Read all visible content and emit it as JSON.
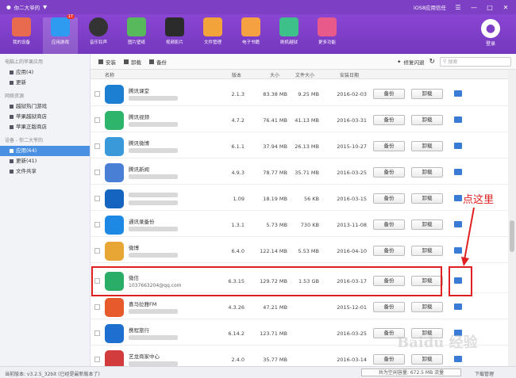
{
  "titlebar": {
    "device": "你二大爷的",
    "device_icon": "apple-icon",
    "brand": "iOS8应用信任"
  },
  "toolbar": {
    "tools": [
      {
        "label": "我的设备",
        "color": "#e86a4f",
        "icon": "store-icon"
      },
      {
        "label": "应用游戏",
        "color": "#2f9bf0",
        "icon": "appstore-icon",
        "badge": "17"
      },
      {
        "label": "音乐铃声",
        "color": "#333333",
        "icon": "music-icon"
      },
      {
        "label": "图片壁纸",
        "color": "#58b85c",
        "icon": "image-icon"
      },
      {
        "label": "视频影片",
        "color": "#2b2b2b",
        "icon": "video-icon"
      },
      {
        "label": "文件管理",
        "color": "#f2a33a",
        "icon": "folder-icon"
      },
      {
        "label": "电子书籍",
        "color": "#f5a142",
        "icon": "book-icon"
      },
      {
        "label": "刷机越狱",
        "color": "#3ec08a",
        "icon": "flash-icon"
      },
      {
        "label": "更多功能",
        "color": "#e85a8a",
        "icon": "grid-icon"
      }
    ],
    "login": "登录"
  },
  "sidebar": {
    "sec1": "电脑上的苹果应用",
    "sec1_items": [
      "应用(4)",
      "更新"
    ],
    "sec2": "网络资源",
    "sec2_items": [
      "越狱热门游戏",
      "苹果越狱商店",
      "苹果正版商店"
    ],
    "sec3": "设备 - 你二大爷的",
    "sec3_items": [
      "应用(64)",
      "更新(41)",
      "文件共享"
    ]
  },
  "actions": {
    "install": "安装",
    "uninstall": "卸载",
    "backup": "备份",
    "fix": "修复闪退",
    "search_placeholder": "搜索"
  },
  "columns": {
    "name": "名称",
    "version": "版本",
    "size": "大小",
    "docsize": "文件大小",
    "date": "安装日期"
  },
  "buttons": {
    "backup": "备份",
    "uninstall": "卸载"
  },
  "rows": [
    {
      "name": "腾讯课堂",
      "sub": "",
      "version": "2.1.3",
      "size": "83.38 MB",
      "docsize": "9.25 MB",
      "date": "2016-02-03",
      "color": "#1d7fd1"
    },
    {
      "name": "腾讯视频",
      "sub": "",
      "version": "4.7.2",
      "size": "76.41 MB",
      "docsize": "41.13 MB",
      "date": "2016-03-31",
      "color": "#2fb56b"
    },
    {
      "name": "腾讯微博",
      "sub": "",
      "version": "6.1.1",
      "size": "37.94 MB",
      "docsize": "26.13 MB",
      "date": "2015-10-27",
      "color": "#3a9ad9"
    },
    {
      "name": "腾讯新闻",
      "sub": "",
      "version": "4.9.3",
      "size": "78.77 MB",
      "docsize": "35.71 MB",
      "date": "2016-03-25",
      "color": "#4a7fd6"
    },
    {
      "name": "",
      "sub": "",
      "version": "1.09",
      "size": "18.19 MB",
      "docsize": "56 KB",
      "date": "2016-03-15",
      "color": "#1565c0"
    },
    {
      "name": "通讯录备份",
      "sub": "",
      "version": "1.3.1",
      "size": "5.73 MB",
      "docsize": "730 KB",
      "date": "2013-11-08",
      "color": "#1e88e5"
    },
    {
      "name": "微博",
      "sub": "",
      "version": "6.4.0",
      "size": "122.14 MB",
      "docsize": "5.53 MB",
      "date": "2016-04-10",
      "color": "#e8a735"
    },
    {
      "name": "微信",
      "sub": "1037663204@qq.com",
      "version": "6.3.15",
      "size": "129.72 MB",
      "docsize": "1.53 GB",
      "date": "2016-03-17",
      "color": "#2aae67"
    },
    {
      "name": "喜马拉雅FM",
      "sub": "",
      "version": "4.3.26",
      "size": "47.21 MB",
      "docsize": "",
      "date": "2015-12-01",
      "color": "#e65a2c"
    },
    {
      "name": "携程旅行",
      "sub": "",
      "version": "6.14.2",
      "size": "123.71 MB",
      "docsize": "",
      "date": "2016-03-25",
      "color": "#1f6fd0"
    },
    {
      "name": "艺龙商家中心",
      "sub": "",
      "version": "2.4.0",
      "size": "35.77 MB",
      "docsize": "",
      "date": "2016-03-14",
      "color": "#d33c3c"
    }
  ],
  "annotation": "点这里",
  "status": {
    "version": "当前版本: v3.2.5_32bit (已经是最新版本了)",
    "capacity": "共为空闲容量: 672.5 MB 流量",
    "download": "下载管理"
  },
  "watermark": "Baidu 经验"
}
